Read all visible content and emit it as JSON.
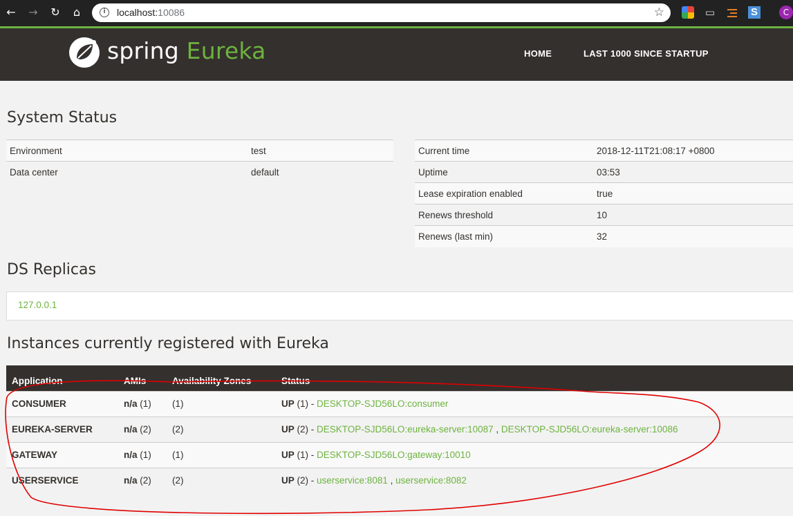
{
  "browser": {
    "url_host": "localhost:",
    "url_port": "10086",
    "profile_initial": "C",
    "icons": [
      "back-icon",
      "forward-icon",
      "reload-icon",
      "home-icon",
      "info-icon",
      "bookmark-star-icon"
    ]
  },
  "colors": {
    "navbar": "#34302d",
    "accent": "#6db33f",
    "annotation": "#e00000"
  },
  "header": {
    "brand_spring": "spring",
    "brand_eureka": "Eureka",
    "nav": {
      "home": "HOME",
      "last1000": "LAST 1000 SINCE STARTUP"
    }
  },
  "system_status": {
    "title": "System Status",
    "left": [
      {
        "label": "Environment",
        "value": "test"
      },
      {
        "label": "Data center",
        "value": "default"
      }
    ],
    "right": [
      {
        "label": "Current time",
        "value": "2018-12-11T21:08:17 +0800"
      },
      {
        "label": "Uptime",
        "value": "03:53"
      },
      {
        "label": "Lease expiration enabled",
        "value": "true"
      },
      {
        "label": "Renews threshold",
        "value": "10"
      },
      {
        "label": "Renews (last min)",
        "value": "32"
      }
    ]
  },
  "ds_replicas": {
    "title": "DS Replicas",
    "replica": "127.0.0.1"
  },
  "instances": {
    "title": "Instances currently registered with Eureka",
    "headers": [
      "Application",
      "AMIs",
      "Availability Zones",
      "Status"
    ],
    "rows": [
      {
        "app": "CONSUMER",
        "amis_na": "n/a",
        "amis_count": "(1)",
        "zones": "(1)",
        "status_up": "UP",
        "status_count": "(1)",
        "sep": " - ",
        "links": [
          "DESKTOP-SJD56LO:consumer"
        ]
      },
      {
        "app": "EUREKA-SERVER",
        "amis_na": "n/a",
        "amis_count": "(2)",
        "zones": "(2)",
        "status_up": "UP",
        "status_count": "(2)",
        "sep": " - ",
        "links": [
          "DESKTOP-SJD56LO:eureka-server:10087",
          "DESKTOP-SJD56LO:eureka-server:10086"
        ]
      },
      {
        "app": "GATEWAY",
        "amis_na": "n/a",
        "amis_count": "(1)",
        "zones": "(1)",
        "status_up": "UP",
        "status_count": "(1)",
        "sep": " - ",
        "links": [
          "DESKTOP-SJD56LO:gateway:10010"
        ]
      },
      {
        "app": "USERSERVICE",
        "amis_na": "n/a",
        "amis_count": "(2)",
        "zones": "(2)",
        "status_up": "UP",
        "status_count": "(2)",
        "sep": " - ",
        "links": [
          "userservice:8081",
          "userservice:8082"
        ]
      }
    ],
    "link_separator": " , "
  }
}
